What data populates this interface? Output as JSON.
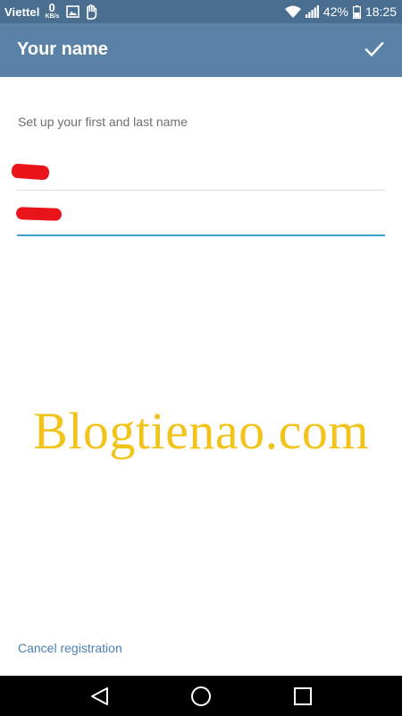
{
  "status_bar": {
    "carrier": "Viettel",
    "net_speed_value": "0",
    "net_speed_unit": "KB/s",
    "battery_percent": "42%",
    "time": "18:25",
    "icons": [
      "image-icon",
      "hand-icon",
      "wifi-icon",
      "signal-icon",
      "battery-icon"
    ]
  },
  "app_bar": {
    "title": "Your name",
    "action_icon": "check-icon"
  },
  "form": {
    "subtitle": "Set up your first and last name",
    "first_name": {
      "value": "",
      "redacted": true
    },
    "last_name": {
      "value": "",
      "redacted": true,
      "focused": true
    }
  },
  "watermark": "Blogtienao.com",
  "cancel_link": "Cancel registration",
  "nav_bar": {
    "icons": [
      "back-icon",
      "home-icon",
      "recents-icon"
    ]
  },
  "colors": {
    "status_bar": "#4a6e8f",
    "app_bar": "#5a81a6",
    "accent": "#3c9fd4",
    "link": "#4a7fb0",
    "watermark": "#f2c31b",
    "redaction": "#e8141a"
  }
}
